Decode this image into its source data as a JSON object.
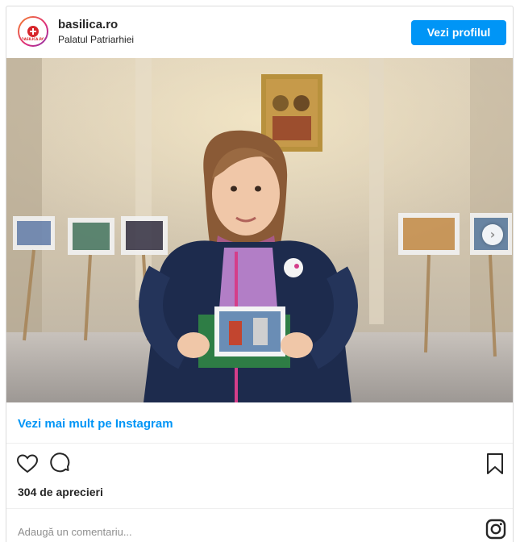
{
  "account": {
    "username": "basilica.ro",
    "location": "Palatul Patriarhiei",
    "avatar_logo": "BASILICA.RO"
  },
  "header": {
    "view_profile_label": "Vezi profilul"
  },
  "photo": {
    "next_icon": "chevron-right-icon"
  },
  "links": {
    "more_on_instagram": "Vezi mai mult pe Instagram"
  },
  "actions": {
    "like_icon": "heart-icon",
    "comment_icon": "comment-icon",
    "save_icon": "bookmark-icon"
  },
  "likes": {
    "text": "304 de aprecieri"
  },
  "comment": {
    "placeholder": "Adaugă un comentariu..."
  },
  "footer": {
    "brand_icon": "instagram-icon"
  },
  "colors": {
    "accent": "#0095f6",
    "text": "#262626",
    "muted": "#8e8e8e"
  }
}
